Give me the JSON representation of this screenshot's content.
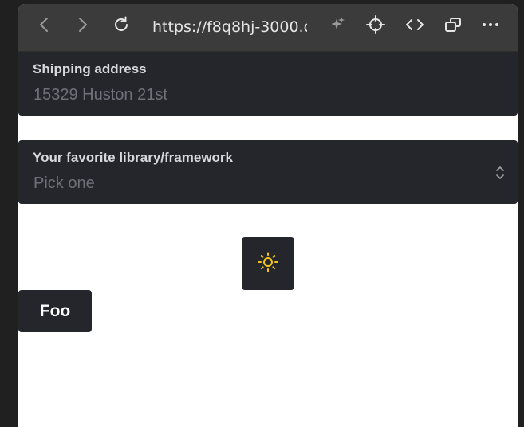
{
  "browser": {
    "url": "https://f8q8hj-3000.c",
    "icons": [
      "back-icon",
      "forward-icon",
      "reload-icon",
      "sparkle-icon",
      "crosshair-icon",
      "code-icon",
      "windows-icon",
      "more-icon"
    ]
  },
  "form": {
    "shipping": {
      "label": "Shipping address",
      "value": "15329 Huston 21st"
    },
    "framework": {
      "label": "Your favorite library/framework",
      "placeholder": "Pick one"
    }
  },
  "theme_toggle": {
    "icon": "sun-icon",
    "icon_color": "#f5c518"
  },
  "foo_button": {
    "label": "Foo"
  },
  "colors": {
    "field_bg": "#25262c",
    "toolbar_bg": "#3b3b3b",
    "page_bg": "#ffffff"
  }
}
